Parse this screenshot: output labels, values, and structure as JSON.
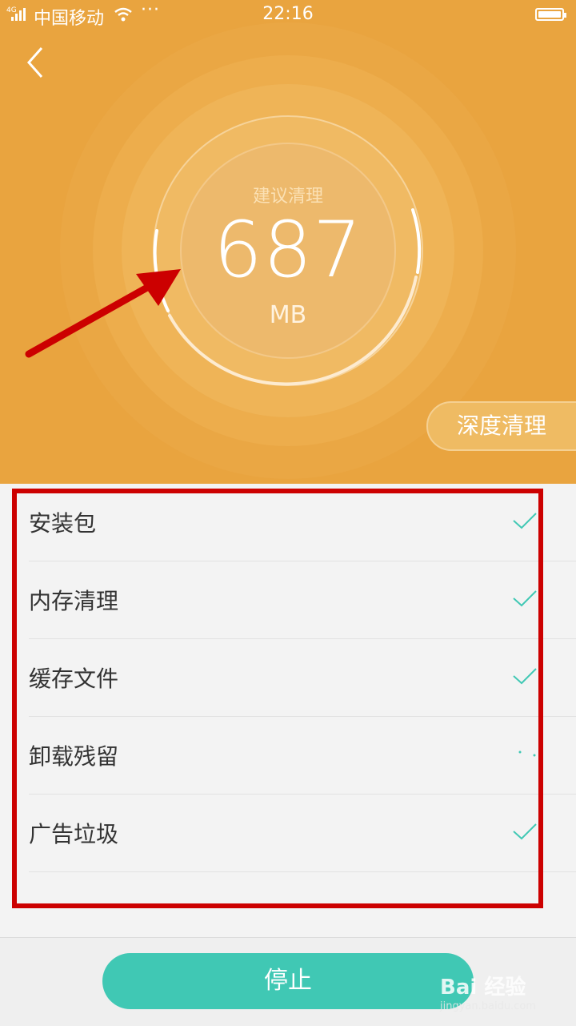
{
  "status_bar": {
    "network": "4G",
    "carrier": "中国移动",
    "more": "···",
    "time": "22:16"
  },
  "clean": {
    "suggest_label": "建议清理",
    "size_value": "687",
    "size_unit": "MB",
    "deep_clean_label": "深度清理"
  },
  "items": [
    {
      "label": "安装包",
      "state": "checked"
    },
    {
      "label": "内存清理",
      "state": "checked"
    },
    {
      "label": "缓存文件",
      "state": "checked"
    },
    {
      "label": "卸载残留",
      "state": "scanning"
    },
    {
      "label": "广告垃圾",
      "state": "checked"
    }
  ],
  "footer": {
    "stop_label": "停止"
  },
  "watermark": {
    "brand": "Bai 经验",
    "url": "jingyan.baidu.com"
  },
  "colors": {
    "header": "#e9a43f",
    "accent": "#40c8b4",
    "annotation": "#cc0000"
  }
}
